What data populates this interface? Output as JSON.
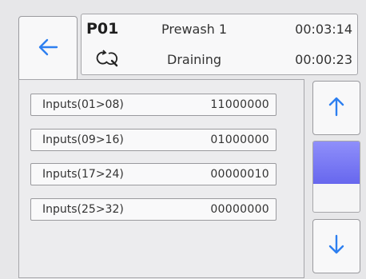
{
  "header": {
    "program": "P01",
    "step_name": "Prewash 1",
    "step_time": "00:03:14",
    "state": "Draining",
    "state_time": "00:00:23",
    "state_icon": "drain-cycle-icon"
  },
  "nav": {
    "back_icon": "arrow-left-icon",
    "up_icon": "arrow-up-icon",
    "down_icon": "arrow-down-icon"
  },
  "inputs": [
    {
      "label": "Inputs(01>08)",
      "value": "11000000"
    },
    {
      "label": "Inputs(09>16)",
      "value": "01000000"
    },
    {
      "label": "Inputs(17>24)",
      "value": "00000010"
    },
    {
      "label": "Inputs(25>32)",
      "value": "00000000"
    }
  ],
  "scroll": {
    "position": 0.0,
    "visible_fraction": 0.6
  },
  "colors": {
    "accent_blue": "#2d7ff0",
    "scroll_thumb": "#7373f2",
    "background": "#e7e7e9"
  }
}
